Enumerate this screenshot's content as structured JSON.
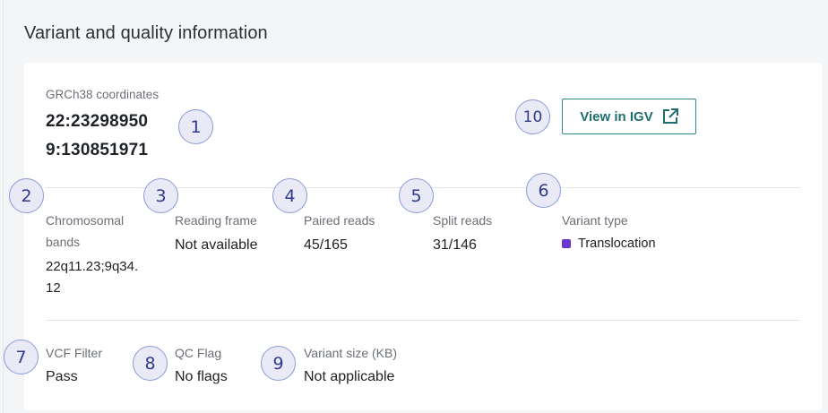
{
  "section_title": "Variant and quality information",
  "coordinates": {
    "label": "GRCh38 coordinates",
    "values": [
      "22:23298950",
      "9:130851971"
    ]
  },
  "igv_button": {
    "label": "View in IGV",
    "icon": "external-link-icon"
  },
  "fields_row1": [
    {
      "label": "Chromosomal",
      "label2": "bands",
      "value": "22q11.23;9q34.",
      "value2": "12"
    },
    {
      "label": "Reading frame",
      "value": "Not available"
    },
    {
      "label": "Paired reads",
      "value": "45/165"
    },
    {
      "label": "Split reads",
      "value": "31/146"
    },
    {
      "label": "Variant type",
      "value": "Translocation",
      "swatch_color": "#6b35d6"
    }
  ],
  "fields_row2": [
    {
      "label": "VCF Filter",
      "value": "Pass"
    },
    {
      "label": "QC Flag",
      "value": "No flags"
    },
    {
      "label": "Variant size (KB)",
      "value": "Not applicable"
    }
  ],
  "badges": [
    "1",
    "2",
    "3",
    "4",
    "5",
    "6",
    "7",
    "8",
    "9",
    "10"
  ],
  "colors": {
    "accent": "#2c8a8a",
    "badge_border": "#8c9ad8",
    "badge_fill": "#e9eaf5"
  }
}
